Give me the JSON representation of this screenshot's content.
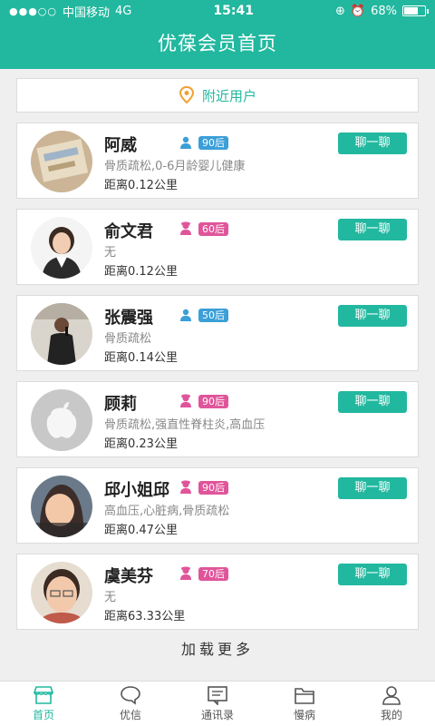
{
  "status_bar": {
    "carrier": "中国移动",
    "network": "4G",
    "time": "15:41",
    "battery": "68%",
    "battery_level": 0.68
  },
  "header": {
    "title": "优葆会员首页"
  },
  "nearby": {
    "label": "附近用户",
    "icon": "location-pin-icon"
  },
  "colors": {
    "accent": "#22b89f",
    "male": "#3b9fd8",
    "female": "#e0559a"
  },
  "users": [
    {
      "name": "阿威",
      "gender": "male",
      "age": "90后",
      "diseases": "骨质疏松,0-6月龄婴儿健康",
      "distance": "距离0.12公里",
      "chat": "聊一聊"
    },
    {
      "name": "俞文君",
      "gender": "female",
      "age": "60后",
      "diseases": "无",
      "distance": "距离0.12公里",
      "chat": "聊一聊"
    },
    {
      "name": "张震强",
      "gender": "male",
      "age": "50后",
      "diseases": "骨质疏松",
      "distance": "距离0.14公里",
      "chat": "聊一聊"
    },
    {
      "name": "顾莉",
      "gender": "female",
      "age": "90后",
      "diseases": "骨质疏松,强直性脊柱炎,高血压",
      "distance": "距离0.23公里",
      "chat": "聊一聊"
    },
    {
      "name": "邱小姐邱",
      "gender": "female",
      "age": "90后",
      "diseases": "高血压,心脏病,骨质疏松",
      "distance": "距离0.47公里",
      "chat": "聊一聊"
    },
    {
      "name": "虞美芬",
      "gender": "female",
      "age": "70后",
      "diseases": "无",
      "distance": "距离63.33公里",
      "chat": "聊一聊"
    }
  ],
  "load_more": "加载更多",
  "tabs": [
    {
      "label": "首页",
      "icon": "home-icon",
      "active": true
    },
    {
      "label": "优信",
      "icon": "chat-bubble-icon",
      "active": false
    },
    {
      "label": "通讯录",
      "icon": "contacts-icon",
      "active": false
    },
    {
      "label": "慢病",
      "icon": "folder-icon",
      "active": false
    },
    {
      "label": "我的",
      "icon": "user-icon",
      "active": false
    }
  ]
}
